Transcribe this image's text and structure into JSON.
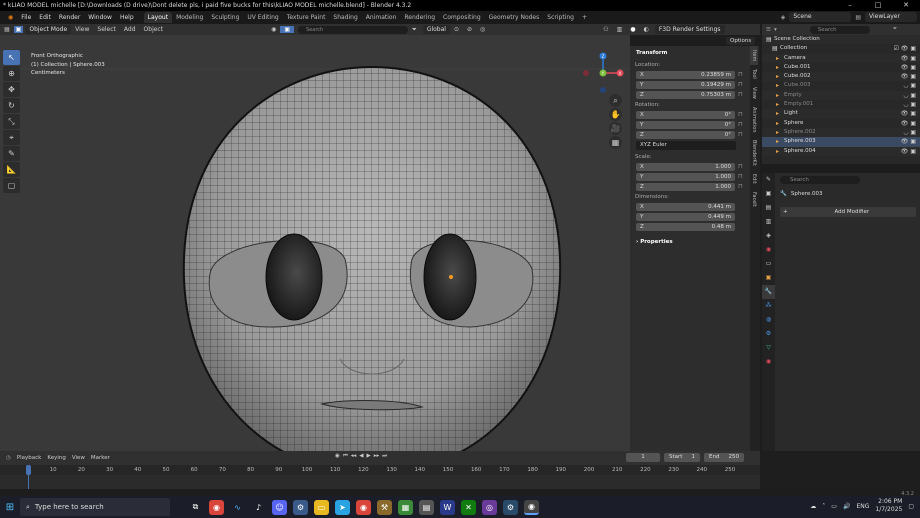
{
  "window": {
    "title": "* kLIAO MODEL michelle [D:\\Downloads (D drive)\\Dont delete pls, i paid five bucks for this\\kLIAO MODEL michelle.blend] - Blender 4.3.2",
    "minimize": "–",
    "maximize": "□",
    "close": "✕"
  },
  "menu": {
    "items": [
      "File",
      "Edit",
      "Render",
      "Window",
      "Help"
    ],
    "workspaces": [
      "Layout",
      "Modeling",
      "Sculpting",
      "UV Editing",
      "Texture Paint",
      "Shading",
      "Animation",
      "Rendering",
      "Compositing",
      "Geometry Nodes",
      "Scripting"
    ],
    "add_tab": "+",
    "scene": "Scene",
    "view_layer": "ViewLayer"
  },
  "viewport_header": {
    "mode": "Object Mode",
    "menus": [
      "View",
      "Select",
      "Add",
      "Object"
    ],
    "transform": "Global",
    "search_placeholder": "Search",
    "render_settings": "F3D Render Settings",
    "options": "Options"
  },
  "viewport_info": {
    "view_name": "Front Orthographic",
    "collection_line": "(1) Collection | Sphere.003",
    "units": "Centimeters"
  },
  "gizmo": {
    "x": "X",
    "y": "Y",
    "z": "Z"
  },
  "n_panel": {
    "transform_title": "Transform",
    "location_label": "Location:",
    "location": [
      {
        "axis": "X",
        "value": "0.23859 m"
      },
      {
        "axis": "Y",
        "value": "0.19429 m"
      },
      {
        "axis": "Z",
        "value": "0.75303 m"
      }
    ],
    "rotation_label": "Rotation:",
    "rotation": [
      {
        "axis": "X",
        "value": "0°"
      },
      {
        "axis": "Y",
        "value": "0°"
      },
      {
        "axis": "Z",
        "value": "0°"
      }
    ],
    "rotation_mode": "XYZ Euler",
    "scale_label": "Scale:",
    "scale": [
      {
        "axis": "X",
        "value": "1.000"
      },
      {
        "axis": "Y",
        "value": "1.000"
      },
      {
        "axis": "Z",
        "value": "1.000"
      }
    ],
    "dimensions_label": "Dimensions:",
    "dimensions": [
      {
        "axis": "X",
        "value": "0.441 m"
      },
      {
        "axis": "Y",
        "value": "0.449 m"
      },
      {
        "axis": "Z",
        "value": "0.48 m"
      }
    ],
    "properties_title": "Properties",
    "tabs": [
      "Item",
      "Tool",
      "View",
      "Animation",
      "BlenderKit",
      "Edit",
      "FaceIt"
    ]
  },
  "outliner": {
    "search_placeholder": "Search",
    "scene_collection": "Scene Collection",
    "collection": "Collection",
    "items": [
      {
        "name": "Camera",
        "dim": false
      },
      {
        "name": "Cube.001",
        "dim": false
      },
      {
        "name": "Cube.002",
        "dim": false
      },
      {
        "name": "Cube.003",
        "dim": true
      },
      {
        "name": "Empty",
        "dim": true
      },
      {
        "name": "Empty.001",
        "dim": true
      },
      {
        "name": "Light",
        "dim": false
      },
      {
        "name": "Sphere",
        "dim": false
      },
      {
        "name": "Sphere.002",
        "dim": true
      },
      {
        "name": "Sphere.003",
        "dim": false
      },
      {
        "name": "Sphere.004",
        "dim": false
      }
    ]
  },
  "properties": {
    "search_placeholder": "Search",
    "object_name": "Sphere.003",
    "add_modifier": "Add Modifier"
  },
  "timeline": {
    "menus": [
      "Playback",
      "Keying",
      "View",
      "Marker"
    ],
    "current_frame": "1",
    "start_label": "Start",
    "start": "1",
    "end_label": "End",
    "end": "250",
    "ticks": [
      "1",
      "10",
      "20",
      "30",
      "40",
      "50",
      "60",
      "70",
      "80",
      "90",
      "100",
      "110",
      "120",
      "130",
      "140",
      "150",
      "160",
      "170",
      "180",
      "190",
      "200",
      "210",
      "220",
      "230",
      "240",
      "250"
    ]
  },
  "status": {
    "version": "4.3.2"
  },
  "taskbar": {
    "search_placeholder": "Type here to search",
    "language": "ENG",
    "time": "2:06 PM",
    "date": "1/7/2025"
  },
  "colors": {
    "accent": "#4772b3",
    "header": "#303030",
    "viewport_bg": "#393939",
    "object_orange": "#e8a24a"
  }
}
